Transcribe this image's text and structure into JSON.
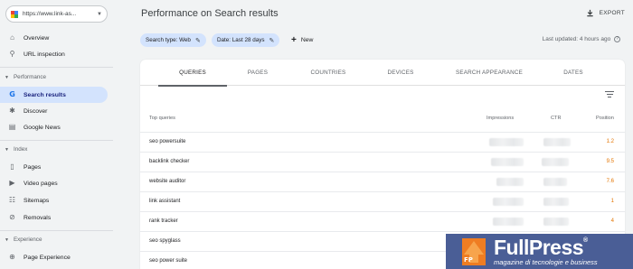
{
  "property": {
    "url": "https://www.link-as..."
  },
  "sidebar": {
    "items": [
      {
        "label": "Overview",
        "icon": "home-icon"
      },
      {
        "label": "URL inspection",
        "icon": "search-icon"
      }
    ],
    "sections": [
      {
        "label": "Performance",
        "items": [
          {
            "label": "Search results",
            "icon": "google-g-icon",
            "active": true
          },
          {
            "label": "Discover",
            "icon": "asterisk-icon"
          },
          {
            "label": "Google News",
            "icon": "news-icon"
          }
        ]
      },
      {
        "label": "Index",
        "items": [
          {
            "label": "Pages",
            "icon": "file-icon"
          },
          {
            "label": "Video pages",
            "icon": "video-file-icon"
          },
          {
            "label": "Sitemaps",
            "icon": "sitemap-icon"
          },
          {
            "label": "Removals",
            "icon": "eye-off-icon"
          }
        ]
      },
      {
        "label": "Experience",
        "items": [
          {
            "label": "Page Experience",
            "icon": "plus-circle-icon"
          }
        ]
      }
    ]
  },
  "header": {
    "title": "Performance on Search results",
    "export_label": "EXPORT",
    "last_updated": "Last updated: 4 hours ago"
  },
  "filters": {
    "search_type": "Search type: Web",
    "date": "Date: Last 28 days",
    "new_label": "New"
  },
  "tabs": [
    "QUERIES",
    "PAGES",
    "COUNTRIES",
    "DEVICES",
    "SEARCH APPEARANCE",
    "DATES"
  ],
  "table": {
    "columns": {
      "query": "Top queries",
      "impressions": "Impressions",
      "ctr": "CTR",
      "position": "Position"
    },
    "rows": [
      {
        "query": "seo powersuite",
        "position": "1.2"
      },
      {
        "query": "backlink checker",
        "position": "9.5"
      },
      {
        "query": "website auditor",
        "position": "7.6"
      },
      {
        "query": "link assistant",
        "position": "1"
      },
      {
        "query": "rank tracker",
        "position": "4"
      },
      {
        "query": "seo spyglass",
        "position": ""
      },
      {
        "query": "seo power suite",
        "position": ""
      }
    ]
  },
  "watermark": {
    "logo_text": "FP",
    "brand": "FullPress",
    "tagline": "magazine di tecnologie e business"
  },
  "colors": {
    "accent": "#1a73e8",
    "active_bg": "#d3e3fd",
    "position_text": "#e37400",
    "watermark_bg": "#4a5e96"
  }
}
